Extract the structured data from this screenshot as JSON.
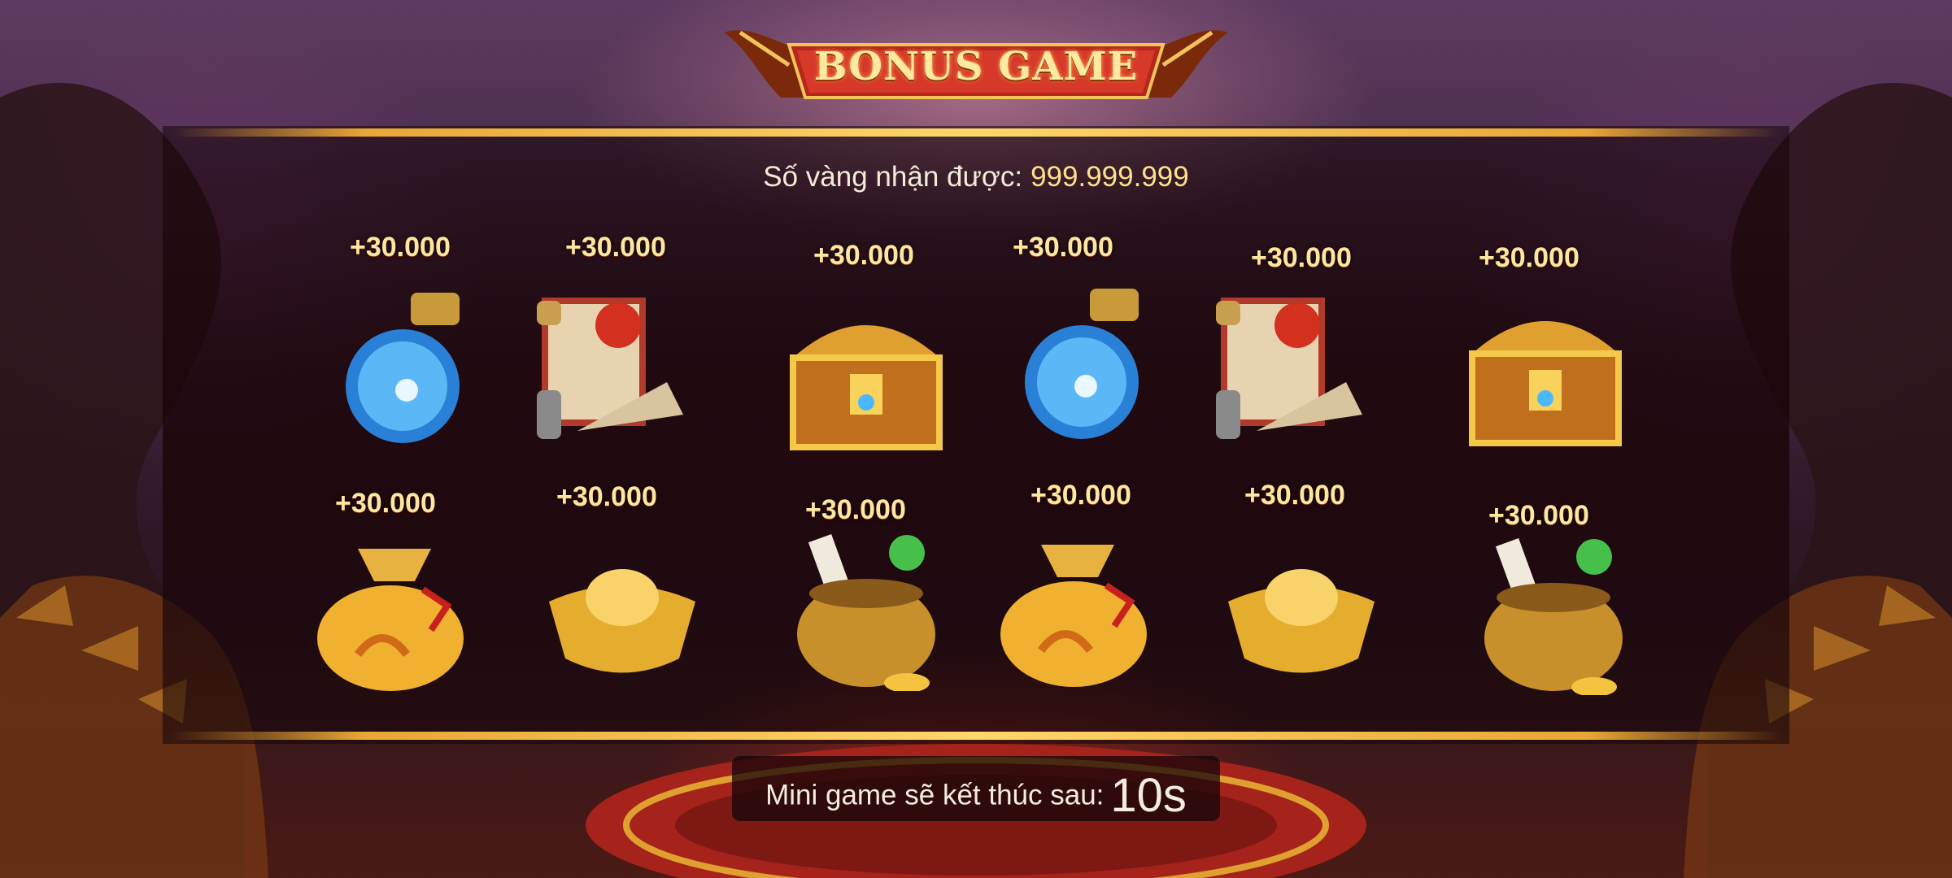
{
  "title": "BONUS GAME",
  "gold": {
    "label": "Số vàng nhận được:",
    "value": "999.999.999"
  },
  "rewards_row1": [
    "+30.000",
    "+30.000",
    "+30.000",
    "+30.000",
    "+30.000",
    "+30.000"
  ],
  "rewards_row2": [
    "+30.000",
    "+30.000",
    "+30.000",
    "+30.000",
    "+30.000",
    "+30.000"
  ],
  "items_row1": [
    "potion-icon",
    "scroll-icon",
    "treasure-chest-icon",
    "potion-icon",
    "scroll-icon",
    "treasure-chest-icon"
  ],
  "items_row2": [
    "gold-bag-icon",
    "gold-ingot-icon",
    "treasure-pot-icon",
    "gold-bag-icon",
    "gold-ingot-icon",
    "treasure-pot-icon"
  ],
  "footer": {
    "label": "Mini game sẽ kết thúc sau:",
    "countdown": "10s"
  },
  "colors": {
    "accent": "#ffd76a",
    "reward_text": "#ffe6a0",
    "panel": "#1c060a"
  }
}
